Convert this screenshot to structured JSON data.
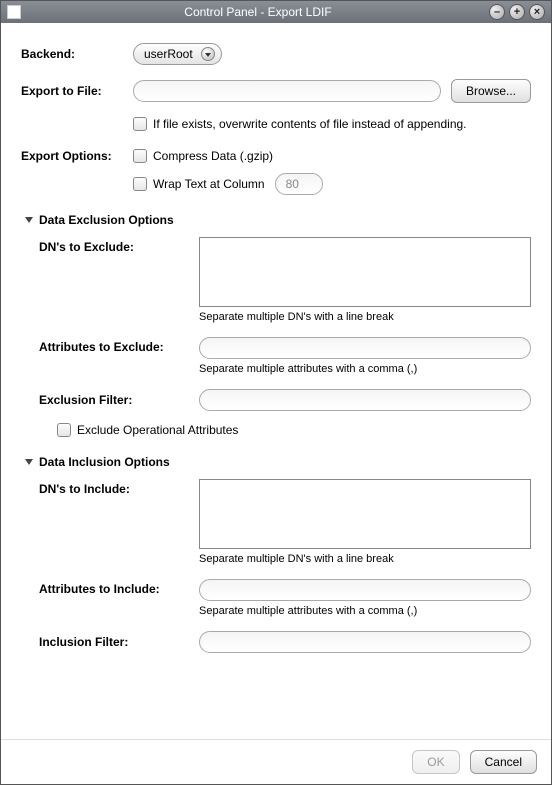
{
  "window": {
    "title": "Control Panel - Export LDIF"
  },
  "labels": {
    "backend": "Backend:",
    "exportToFile": "Export to File:",
    "exportOptions": "Export Options:"
  },
  "backend": {
    "selected": "userRoot",
    "options": [
      "userRoot"
    ]
  },
  "exportFile": {
    "value": ""
  },
  "buttons": {
    "browse": "Browse...",
    "ok": "OK",
    "cancel": "Cancel"
  },
  "checks": {
    "overwrite": "If file exists, overwrite contents of file instead of appending.",
    "compress": "Compress Data (.gzip)",
    "wrap": "Wrap Text at Column",
    "excludeOp": "Exclude Operational Attributes"
  },
  "wrapColumn": "80",
  "sections": {
    "exclusion": "Data Exclusion Options",
    "inclusion": "Data Inclusion Options"
  },
  "exclusion": {
    "dnLabel": "DN's to Exclude:",
    "dnValue": "",
    "dnHint": "Separate multiple DN's with a line break",
    "attrLabel": "Attributes to Exclude:",
    "attrValue": "",
    "attrHint": "Separate multiple attributes with a comma (,)",
    "filterLabel": "Exclusion Filter:",
    "filterValue": ""
  },
  "inclusion": {
    "dnLabel": "DN's to Include:",
    "dnValue": "",
    "dnHint": "Separate multiple DN's with a line break",
    "attrLabel": "Attributes to Include:",
    "attrValue": "",
    "attrHint": "Separate multiple attributes with a comma (,)",
    "filterLabel": "Inclusion Filter:",
    "filterValue": ""
  }
}
